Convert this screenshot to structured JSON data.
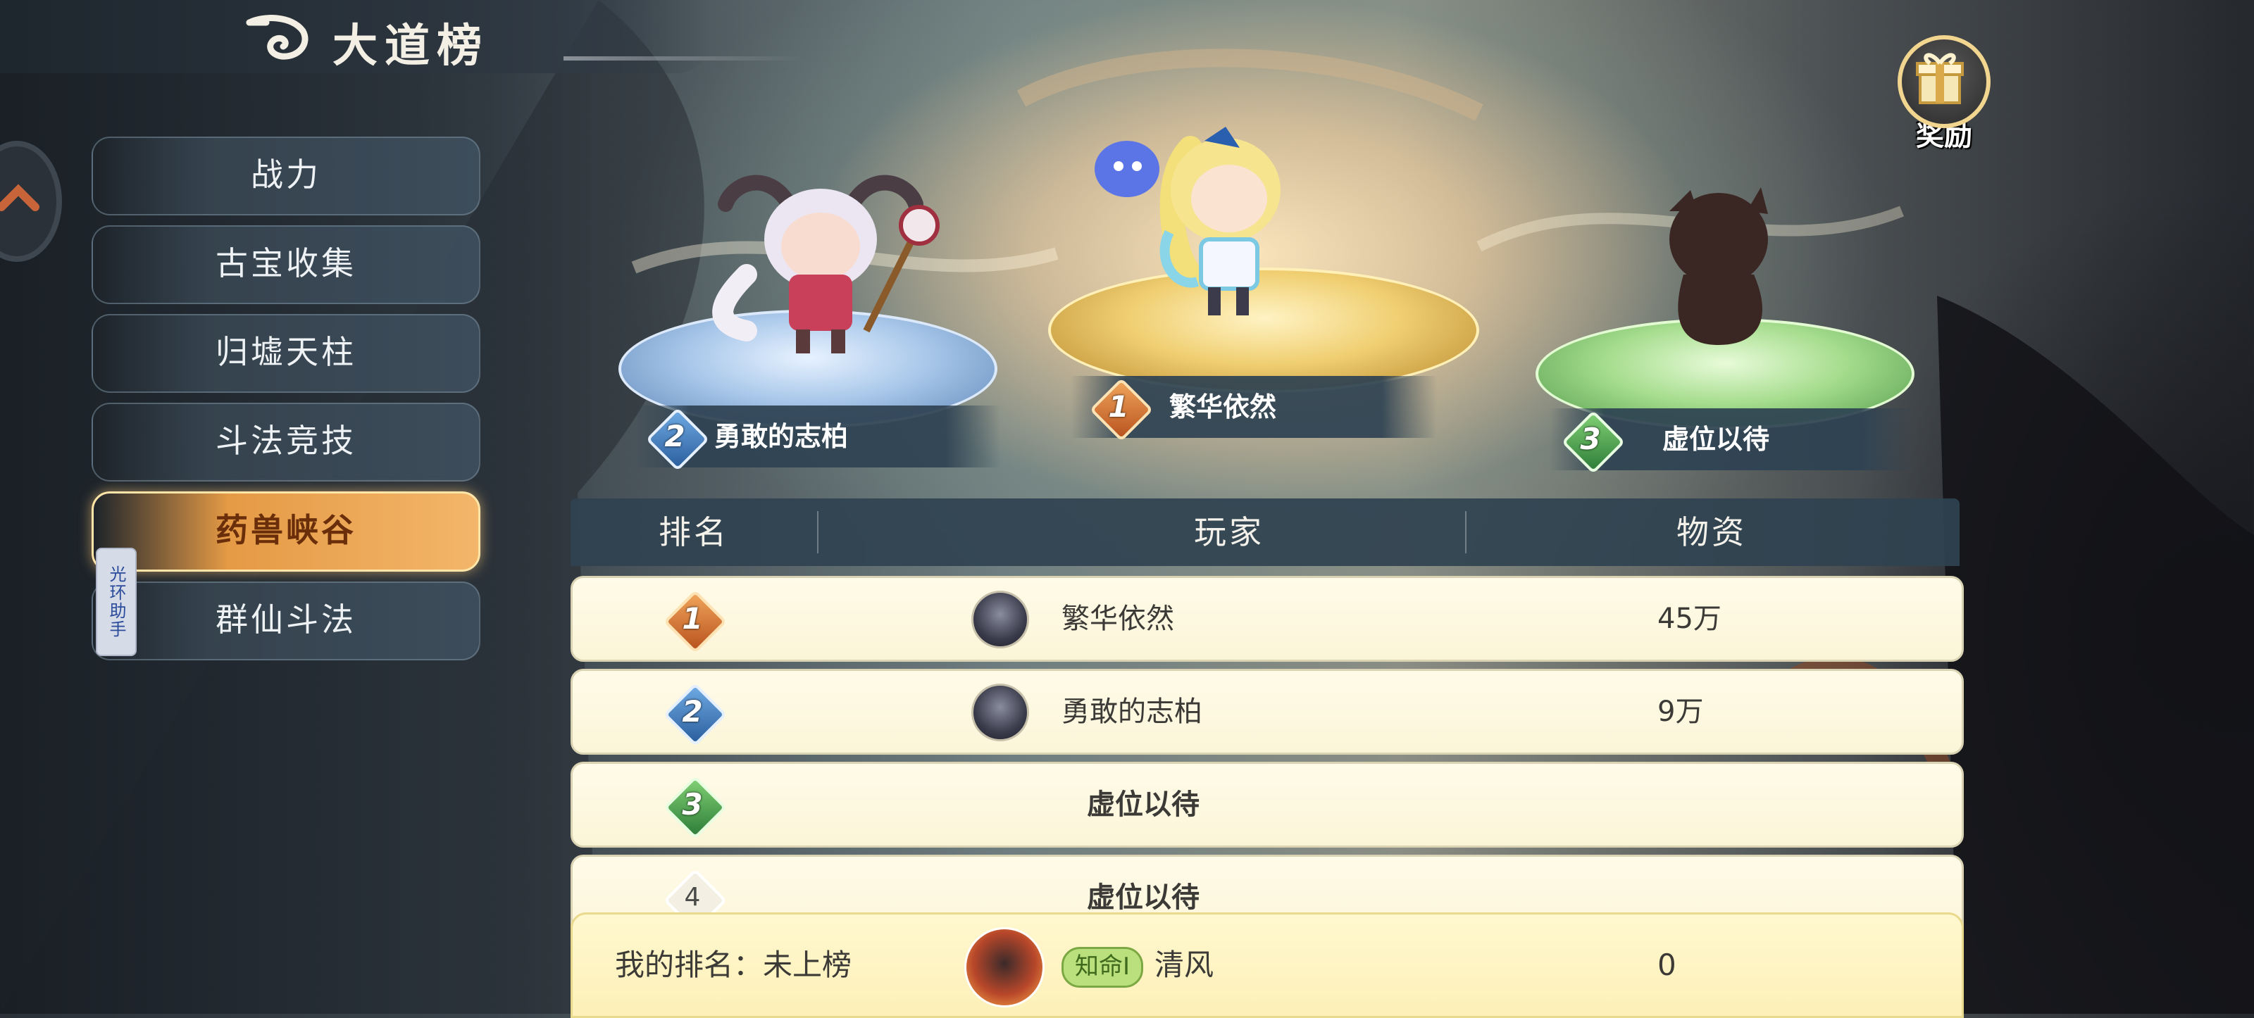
{
  "header": {
    "title": "大道榜"
  },
  "helper_tab": {
    "label": "光环助手"
  },
  "reward": {
    "label": "奖励"
  },
  "sidebar": {
    "items": [
      {
        "label": "战力",
        "active": false
      },
      {
        "label": "古宝收集",
        "active": false
      },
      {
        "label": "归墟天柱",
        "active": false
      },
      {
        "label": "斗法竞技",
        "active": false
      },
      {
        "label": "药兽峡谷",
        "active": true
      },
      {
        "label": "群仙斗法",
        "active": false
      }
    ]
  },
  "podium": {
    "first": {
      "rank": "1",
      "name": "繁华依然"
    },
    "second": {
      "rank": "2",
      "name": "勇敢的志柏"
    },
    "third": {
      "rank": "3",
      "name": "虚位以待"
    }
  },
  "table": {
    "headers": [
      "排名",
      "玩家",
      "物资"
    ],
    "rows": [
      {
        "rank": "1",
        "player": "繁华依然",
        "amount": "45万"
      },
      {
        "rank": "2",
        "player": "勇敢的志柏",
        "amount": "9万"
      },
      {
        "rank": "3",
        "player": "虚位以待",
        "amount": ""
      },
      {
        "rank": "4",
        "player": "虚位以待",
        "amount": ""
      }
    ]
  },
  "my_rank": {
    "label": "我的排名：未上榜",
    "title_badge": "知命Ⅰ",
    "name": "清风",
    "amount": "0"
  },
  "colors": {
    "gold_rank": "#d0702e",
    "blue_rank": "#3f79bd",
    "green_rank": "#4ea04a",
    "active_tab": "#efa857"
  }
}
